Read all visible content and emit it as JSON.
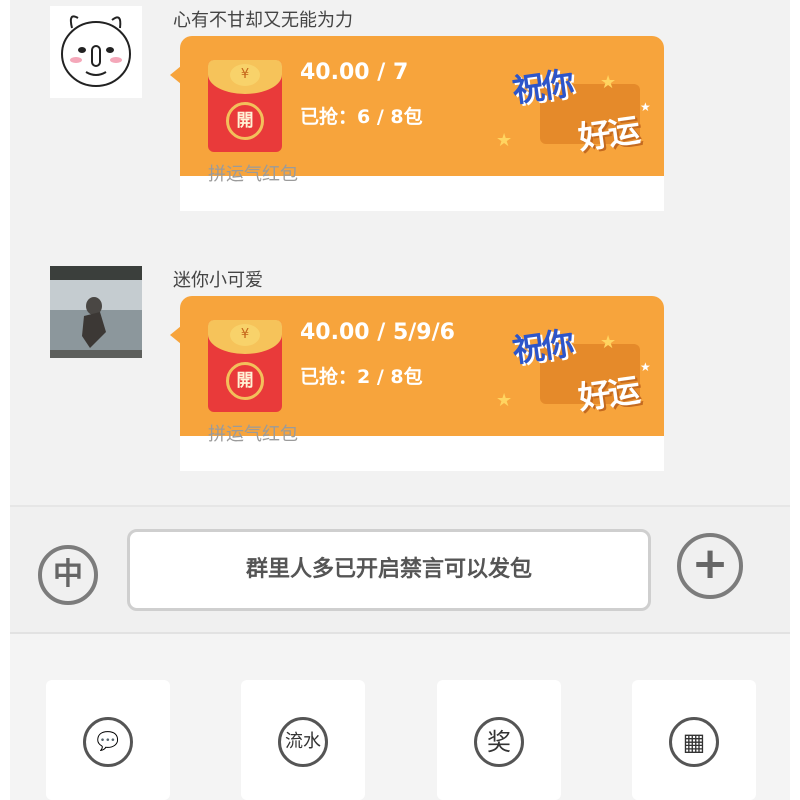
{
  "messages": [
    {
      "sender": "心有不甘却又无能为力",
      "amount": "40.00 / 7",
      "grabbed": "已抢：6 / 8包",
      "packet_label": "拼运气红包",
      "envelope_seal": "開",
      "envelope_coin": "¥",
      "luck_line1": "祝你",
      "luck_line2": "好运"
    },
    {
      "sender": "迷你小可爱",
      "amount": "40.00 / 5/9/6",
      "grabbed": "已抢：2 / 8包",
      "packet_label": "拼运气红包",
      "envelope_seal": "開",
      "envelope_coin": "¥",
      "luck_line1": "祝你",
      "luck_line2": "好运"
    }
  ],
  "composer": {
    "lang_button": "中",
    "input_text": "群里人多已开启禁言可以发包",
    "plus_button": "+"
  },
  "toolbar": {
    "items": [
      {
        "icon": "chat-bubbles-icon",
        "glyph": "💬"
      },
      {
        "icon": "liushui-icon",
        "glyph": "流水"
      },
      {
        "icon": "reward-icon",
        "glyph": "奖"
      },
      {
        "icon": "calculator-icon",
        "glyph": "▦"
      }
    ]
  },
  "colors": {
    "packet_orange": "#f7a43c",
    "envelope_red": "#e93a3a",
    "luck_blue": "#2d55c9"
  }
}
